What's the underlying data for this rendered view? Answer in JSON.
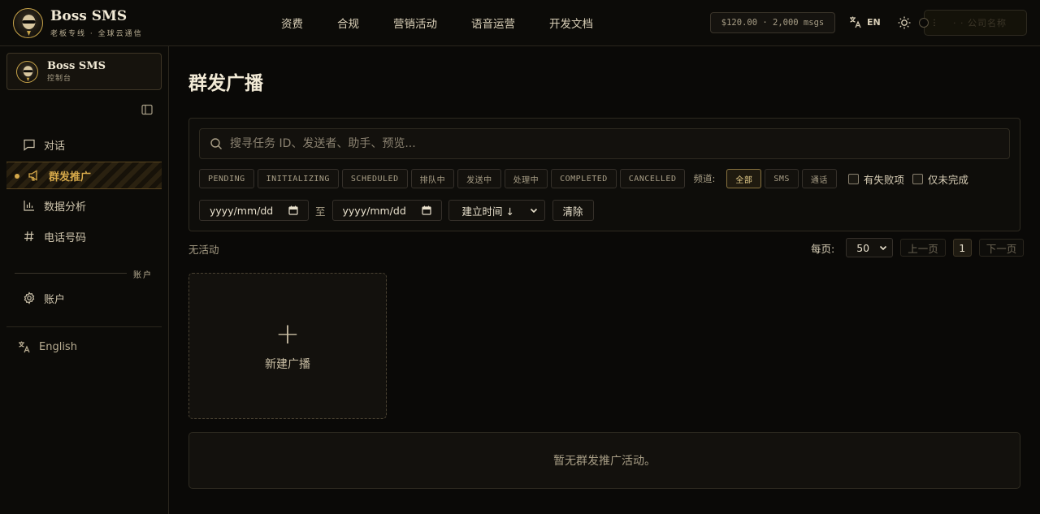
{
  "header": {
    "brand_title": "Boss SMS",
    "brand_subtitle": "老板专线 · 全球云通信",
    "nav": [
      "资费",
      "合规",
      "营销活动",
      "语音运营",
      "开发文档"
    ],
    "balance": "$120.00 · 2,000 msgs",
    "language": "EN",
    "user_label": "· · 公司名称",
    "icons": {
      "lang": "translate-icon",
      "theme": "sun-icon"
    }
  },
  "sidebar": {
    "console_title": "Boss SMS",
    "console_subtitle": "控制台",
    "items": [
      {
        "label": "对话",
        "icon": "chat-icon"
      },
      {
        "label": "群发推广",
        "icon": "megaphone-icon",
        "active": true
      },
      {
        "label": "数据分析",
        "icon": "bar-chart-icon"
      },
      {
        "label": "电话号码",
        "icon": "hash-icon"
      }
    ],
    "section_label": "账户",
    "account_item": {
      "label": "账户",
      "icon": "gear-icon"
    },
    "language_label": "English"
  },
  "main": {
    "title": "群发广播",
    "search_placeholder": "搜寻任务 ID、发送者、助手、预览...",
    "status_chips": [
      "PENDING",
      "INITIALIZING",
      "SCHEDULED",
      "排队中",
      "发送中",
      "处理中",
      "COMPLETED",
      "CANCELLED"
    ],
    "channel_label": "频道:",
    "channel_chips": [
      "全部",
      "SMS",
      "通话"
    ],
    "checkbox_failed": "有失败项",
    "checkbox_incomplete": "仅未完成",
    "date_from": "yyyy/mm/dd",
    "date_sep": "至",
    "date_to": "yyyy/mm/dd",
    "sort_value": "建立时间 ↓",
    "clear_label": "清除",
    "status_text": "无活动",
    "per_page_label": "每页:",
    "per_page_value": "50",
    "prev_label": "上一页",
    "page_number": "1",
    "next_label": "下一页",
    "new_card_plus": "+",
    "new_card_label": "新建广播",
    "empty_text": "暂无群发推广活动。"
  },
  "colors": {
    "accent": "#d6a94a",
    "background": "#0a0907",
    "border": "#2e2a20"
  }
}
